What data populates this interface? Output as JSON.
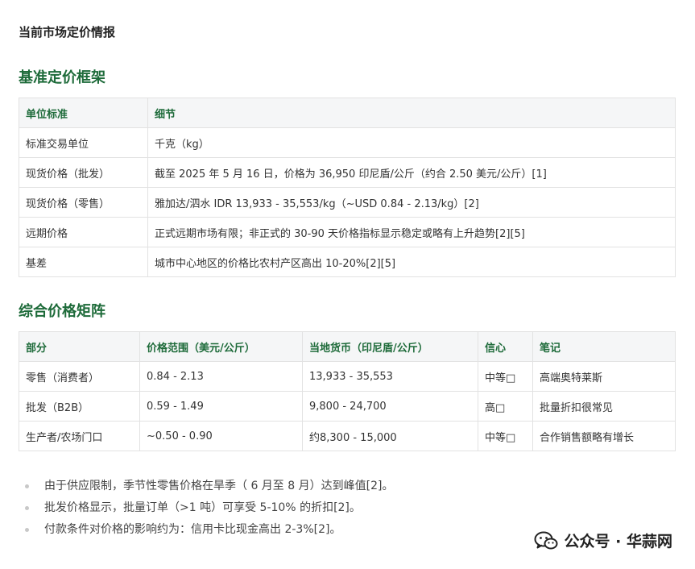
{
  "document": {
    "title": "当前市场定价情报"
  },
  "section1": {
    "heading": "基准定价框架",
    "headers": [
      "单位标准",
      "细节"
    ],
    "rows": [
      [
        "标准交易单位",
        "千克（kg）"
      ],
      [
        "现货价格（批发）",
        "截至 2025 年 5 月 16 日，价格为 36,950 印尼盾/公斤（约合 2.50 美元/公斤）[1]"
      ],
      [
        "现货价格（零售）",
        "雅加达/泗水 IDR 13,933 - 35,553/kg（~USD 0.84 - 2.13/kg）[2]"
      ],
      [
        "远期价格",
        "正式远期市场有限；非正式的 30-90 天价格指标显示稳定或略有上升趋势[2][5]"
      ],
      [
        "基差",
        "城市中心地区的价格比农村产区高出 10-20%[2][5]"
      ]
    ]
  },
  "section2": {
    "heading": "综合价格矩阵",
    "headers": [
      "部分",
      "价格范围（美元/公斤）",
      "当地货币（印尼盾/公斤）",
      "信心",
      "笔记"
    ],
    "rows": [
      [
        "零售（消费者）",
        "0.84 - 2.13",
        "13,933 - 35,553",
        "中等□",
        "高端奥特莱斯"
      ],
      [
        "批发（B2B）",
        "0.59 - 1.49",
        "9,800 - 24,700",
        "高□",
        "批量折扣很常见"
      ],
      [
        "生产者/农场门口",
        "~0.50 - 0.90",
        "约8,300 - 15,000",
        "中等□",
        "合作销售额略有增长"
      ]
    ]
  },
  "notes": [
    "由于供应限制，季节性零售价格在旱季（ 6 月至 8 月）达到峰值[2]。",
    "批发价格显示，批量订单（>1 吨）可享受 5-10% 的折扣[2]。",
    "付款条件对价格的影响约为：信用卡比现金高出 2-3%[2]。"
  ],
  "watermark": {
    "text": "公众号 · 华蒜网",
    "icon": "wechat-icon",
    "color": "#222222"
  },
  "colors": {
    "heading": "#1e6b3a",
    "header_bg": "#f5f6f7",
    "border": "#e2e2e2"
  }
}
